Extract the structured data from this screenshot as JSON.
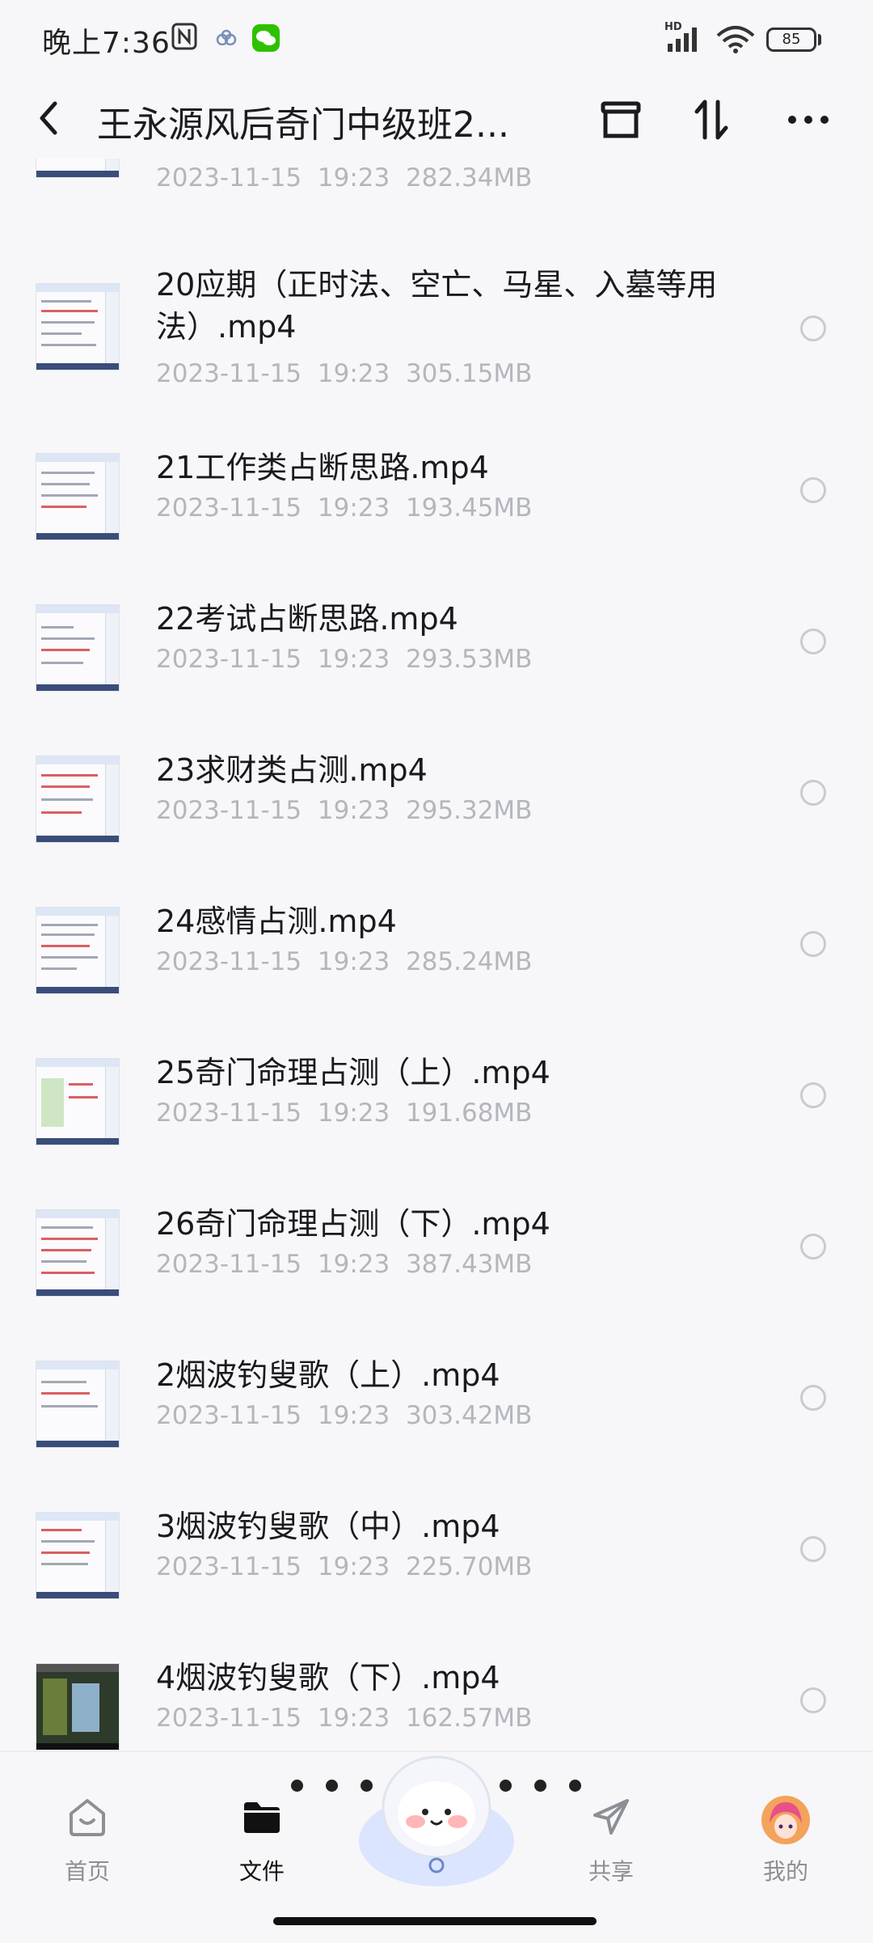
{
  "status_bar": {
    "time": "晚上7:36",
    "network": "HD",
    "battery": "85"
  },
  "title_bar": {
    "title": "王永源风后奇门中级班2..."
  },
  "files": [
    {
      "name": "",
      "date": "2023-11-15",
      "time": "19:23",
      "size": "282.34MB"
    },
    {
      "name": "20应期（正时法、空亡、马星、入墓等用法）.mp4",
      "date": "2023-11-15",
      "time": "19:23",
      "size": "305.15MB"
    },
    {
      "name": "21工作类占断思路.mp4",
      "date": "2023-11-15",
      "time": "19:23",
      "size": "193.45MB"
    },
    {
      "name": "22考试占断思路.mp4",
      "date": "2023-11-15",
      "time": "19:23",
      "size": "293.53MB"
    },
    {
      "name": "23求财类占测.mp4",
      "date": "2023-11-15",
      "time": "19:23",
      "size": "295.32MB"
    },
    {
      "name": "24感情占测.mp4",
      "date": "2023-11-15",
      "time": "19:23",
      "size": "285.24MB"
    },
    {
      "name": "25奇门命理占测（上）.mp4",
      "date": "2023-11-15",
      "time": "19:23",
      "size": "191.68MB"
    },
    {
      "name": "26奇门命理占测（下）.mp4",
      "date": "2023-11-15",
      "time": "19:23",
      "size": "387.43MB"
    },
    {
      "name": "2烟波钓叟歌（上）.mp4",
      "date": "2023-11-15",
      "time": "19:23",
      "size": "303.42MB"
    },
    {
      "name": "3烟波钓叟歌（中）.mp4",
      "date": "2023-11-15",
      "time": "19:23",
      "size": "225.70MB"
    },
    {
      "name": "4烟波钓叟歌（下）.mp4",
      "date": "2023-11-15",
      "time": "19:23",
      "size": "162.57MB"
    }
  ],
  "bottom_nav": {
    "home": "首页",
    "files": "文件",
    "share": "共享",
    "mine": "我的"
  }
}
